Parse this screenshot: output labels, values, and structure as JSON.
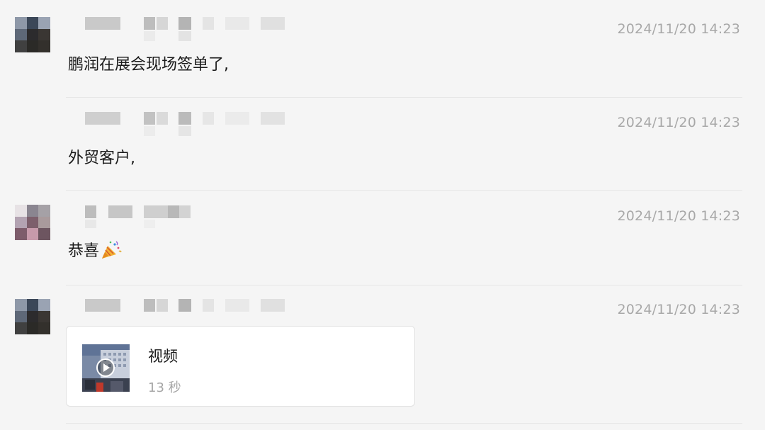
{
  "colors": {
    "background": "#f5f5f5",
    "timestamp": "#a8a8a8",
    "divider": "#e6e6e6",
    "card_border": "#e2e2e2"
  },
  "messages": [
    {
      "avatar": "avatar-blurred",
      "timestamp": "2024/11/20 14:23",
      "text": "鹏润在展会现场签单了,"
    },
    {
      "avatar": null,
      "timestamp": "2024/11/20 14:23",
      "text": "外贸客户,"
    },
    {
      "avatar": "avatar-blurred",
      "timestamp": "2024/11/20 14:23",
      "text": "恭喜",
      "emoji": "party-popper-icon"
    },
    {
      "avatar": "avatar-blurred",
      "timestamp": "2024/11/20 14:23",
      "video": {
        "title": "视频",
        "duration": "13 秒",
        "icon": "play-icon"
      }
    }
  ]
}
